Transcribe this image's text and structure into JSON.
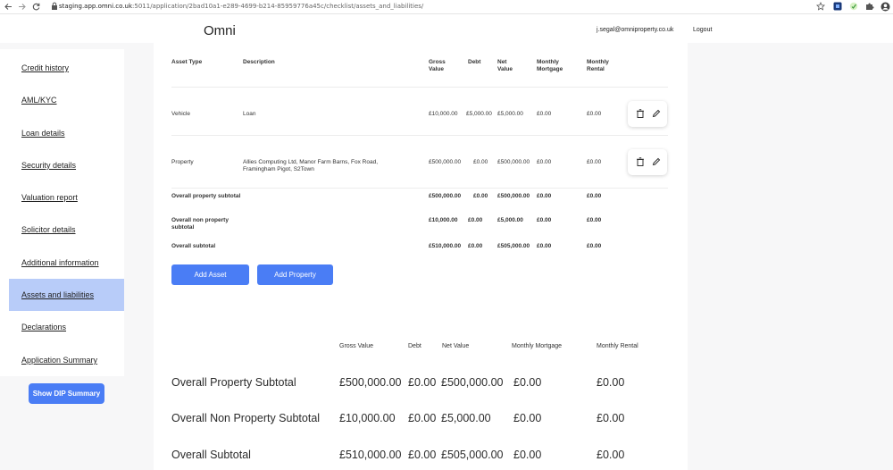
{
  "browser": {
    "url_host": "staging.app.omni.co.uk",
    "url_rest": ":5011/application/2bad10a1-e289-4699-b214-85959776a45c/checklist/assets_and_liabilities/"
  },
  "header": {
    "brand": "Omni",
    "user_email": "j.segal@omniproperty.co.uk",
    "logout_label": "Logout"
  },
  "sidebar": {
    "items": [
      {
        "label": "Credit history"
      },
      {
        "label": "AML/KYC"
      },
      {
        "label": "Loan details"
      },
      {
        "label": "Security details"
      },
      {
        "label": "Valuation report"
      },
      {
        "label": "Solicitor details"
      },
      {
        "label": "Additional information"
      },
      {
        "label": "Assets and liabilities"
      },
      {
        "label": "Declarations"
      },
      {
        "label": "Application Summary"
      }
    ],
    "active_label": "Assets and liabilities"
  },
  "dip_summary_button": "Show DIP Summary",
  "assets_table": {
    "headers": {
      "asset_type": "Asset Type",
      "description": "Description",
      "gross_value": "Gross Value",
      "debt": "Debt",
      "net_value": "Net Value",
      "monthly_mortgage": "Monthly Mortgage",
      "monthly_rental": "Monthly Rental"
    },
    "rows": [
      {
        "asset_type": "Vehicle",
        "description": "Loan",
        "gross_value": "£10,000.00",
        "debt": "£5,000.00",
        "net_value": "£5,000.00",
        "monthly_mortgage": "£0.00",
        "monthly_rental": "£0.00"
      },
      {
        "asset_type": "Property",
        "description": "Allies Computing Ltd, Manor Farm Barns, Fox Road, Framingham Pigot, S2Town",
        "gross_value": "£500,000.00",
        "debt": "£0.00",
        "net_value": "£500,000.00",
        "monthly_mortgage": "£0.00",
        "monthly_rental": "£0.00"
      }
    ],
    "subtotals": [
      {
        "label": "Overall property subtotal",
        "gross_value": "£500,000.00",
        "debt": "£0.00",
        "net_value": "£500,000.00",
        "monthly_mortgage": "£0.00",
        "monthly_rental": "£0.00"
      },
      {
        "label": "Overall non property subtotal",
        "gross_value": "£10,000.00",
        "debt": "£0.00",
        "net_value": "£5,000.00",
        "monthly_mortgage": "£0.00",
        "monthly_rental": "£0.00"
      },
      {
        "label": "Overall subtotal",
        "gross_value": "£510,000.00",
        "debt": "£0.00",
        "net_value": "£505,000.00",
        "monthly_mortgage": "£0.00",
        "monthly_rental": "£0.00"
      }
    ]
  },
  "buttons": {
    "add_asset": "Add Asset",
    "add_property": "Add Property"
  },
  "summary_table": {
    "headers": {
      "gross_value": "Gross Value",
      "debt": "Debt",
      "net_value": "Net Value",
      "monthly_mortgage": "Monthly Mortgage",
      "monthly_rental": "Monthly Rental"
    },
    "rows": [
      {
        "label": "Overall Property Subtotal",
        "gross_value": "£500,000.00",
        "debt": "£0.00",
        "net_value": "£500,000.00",
        "monthly_mortgage": "£0.00",
        "monthly_rental": "£0.00"
      },
      {
        "label": "Overall Non Property Subtotal",
        "gross_value": "£10,000.00",
        "debt": "£0.00",
        "net_value": "£5,000.00",
        "monthly_mortgage": "£0.00",
        "monthly_rental": "£0.00"
      },
      {
        "label": "Overall Subtotal",
        "gross_value": "£510,000.00",
        "debt": "£0.00",
        "net_value": "£505,000.00",
        "monthly_mortgage": "£0.00",
        "monthly_rental": "£0.00"
      }
    ]
  },
  "colors": {
    "primary": "#4a7df5",
    "active_nav": "#b8ccf9",
    "panel": "#ffffff",
    "background": "#f7f7f8"
  },
  "icons": {
    "row_actions": [
      "trash-icon",
      "pencil-icon"
    ],
    "browser": [
      "back-arrow-icon",
      "forward-arrow-icon",
      "reload-icon",
      "lock-icon",
      "star-icon",
      "extension-icon",
      "puzzle-icon",
      "profile-icon"
    ]
  }
}
